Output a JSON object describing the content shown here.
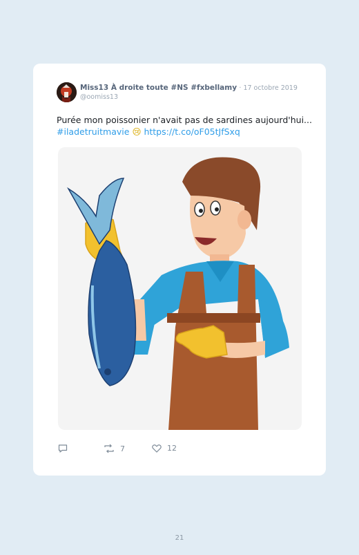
{
  "tweet": {
    "author_name": "Miss13 À droite toute #NS #fxbellamy",
    "date": "· 17 octobre 2019",
    "handle": "@oomiss13",
    "text_line1": "Purée mon poissonier n'avait pas de sardines aujourd'hui...",
    "hashtag": "#iladetruitmavie",
    "emoji": "😢",
    "link": "https://t.co/oF05tJfSxq",
    "media_description_icon": "cartoon-fishmonger-image"
  },
  "actions": {
    "reply_count": "",
    "retweet_count": "7",
    "like_count": "12"
  },
  "page": {
    "number": "21"
  },
  "colors": {
    "background": "#e1ecf4",
    "link": "#2f9de8",
    "muted": "#9aa6b3"
  }
}
